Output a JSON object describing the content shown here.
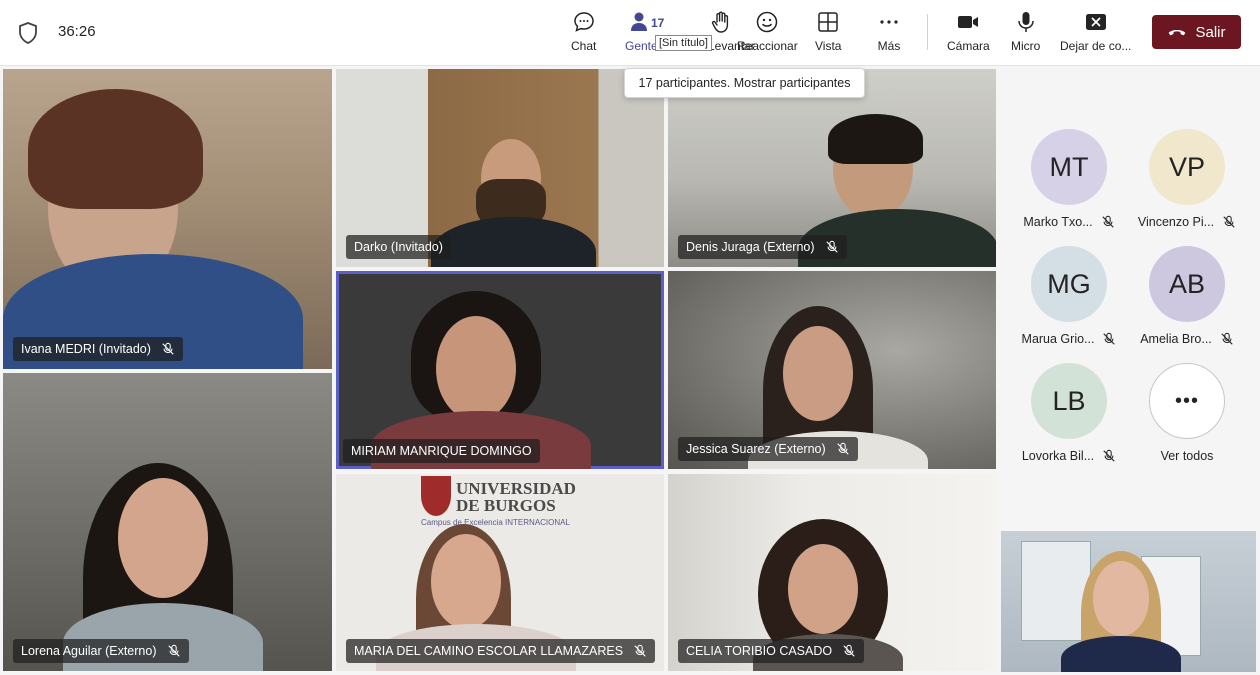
{
  "header": {
    "timer": "36:26",
    "people_count": "17",
    "tooltip_small": "[Sin título]",
    "tooltip": "17 participantes. Mostrar participantes",
    "buttons": {
      "chat": "Chat",
      "people": "Gente",
      "raise": "Levantar",
      "react": "Reaccionar",
      "view": "Vista",
      "more": "Más",
      "camera": "Cámara",
      "mic": "Micro",
      "share": "Dejar de co...",
      "leave": "Salir"
    },
    "colors": {
      "leave": "#6b1620",
      "accent": "#444791"
    }
  },
  "tiles": [
    {
      "name": "Ivana MEDRI (Invitado)"
    },
    {
      "name": "Darko (Invitado)"
    },
    {
      "name": "Denis Juraga (Externo)"
    },
    {
      "name": "MIRIAM MANRIQUE DOMINGO"
    },
    {
      "name": "Jessica Suarez (Externo)"
    },
    {
      "name": "Lorena Aguilar (Externo)"
    },
    {
      "name": "MARIA DEL CAMINO ESCOLAR LLAMAZARES"
    },
    {
      "name": "CELIA TORIBIO CASADO"
    }
  ],
  "backdrop": {
    "university": "UNIVERSIDAD",
    "university_line2": "DE BURGOS",
    "campus": "Campus de Excelencia INTERNACIONAL"
  },
  "avatars": [
    {
      "initials": "MT",
      "name": "Marko Txo...",
      "color": "#d6d1e6"
    },
    {
      "initials": "VP",
      "name": "Vincenzo Pi...",
      "color": "#f1e7cd"
    },
    {
      "initials": "MG",
      "name": "Marua Grio...",
      "color": "#d3dfe4"
    },
    {
      "initials": "AB",
      "name": "Amelia Bro...",
      "color": "#cdc8e0"
    },
    {
      "initials": "LB",
      "name": "Lovorka Bil...",
      "color": "#d2e2d6"
    }
  ],
  "see_all": "Ver todos"
}
